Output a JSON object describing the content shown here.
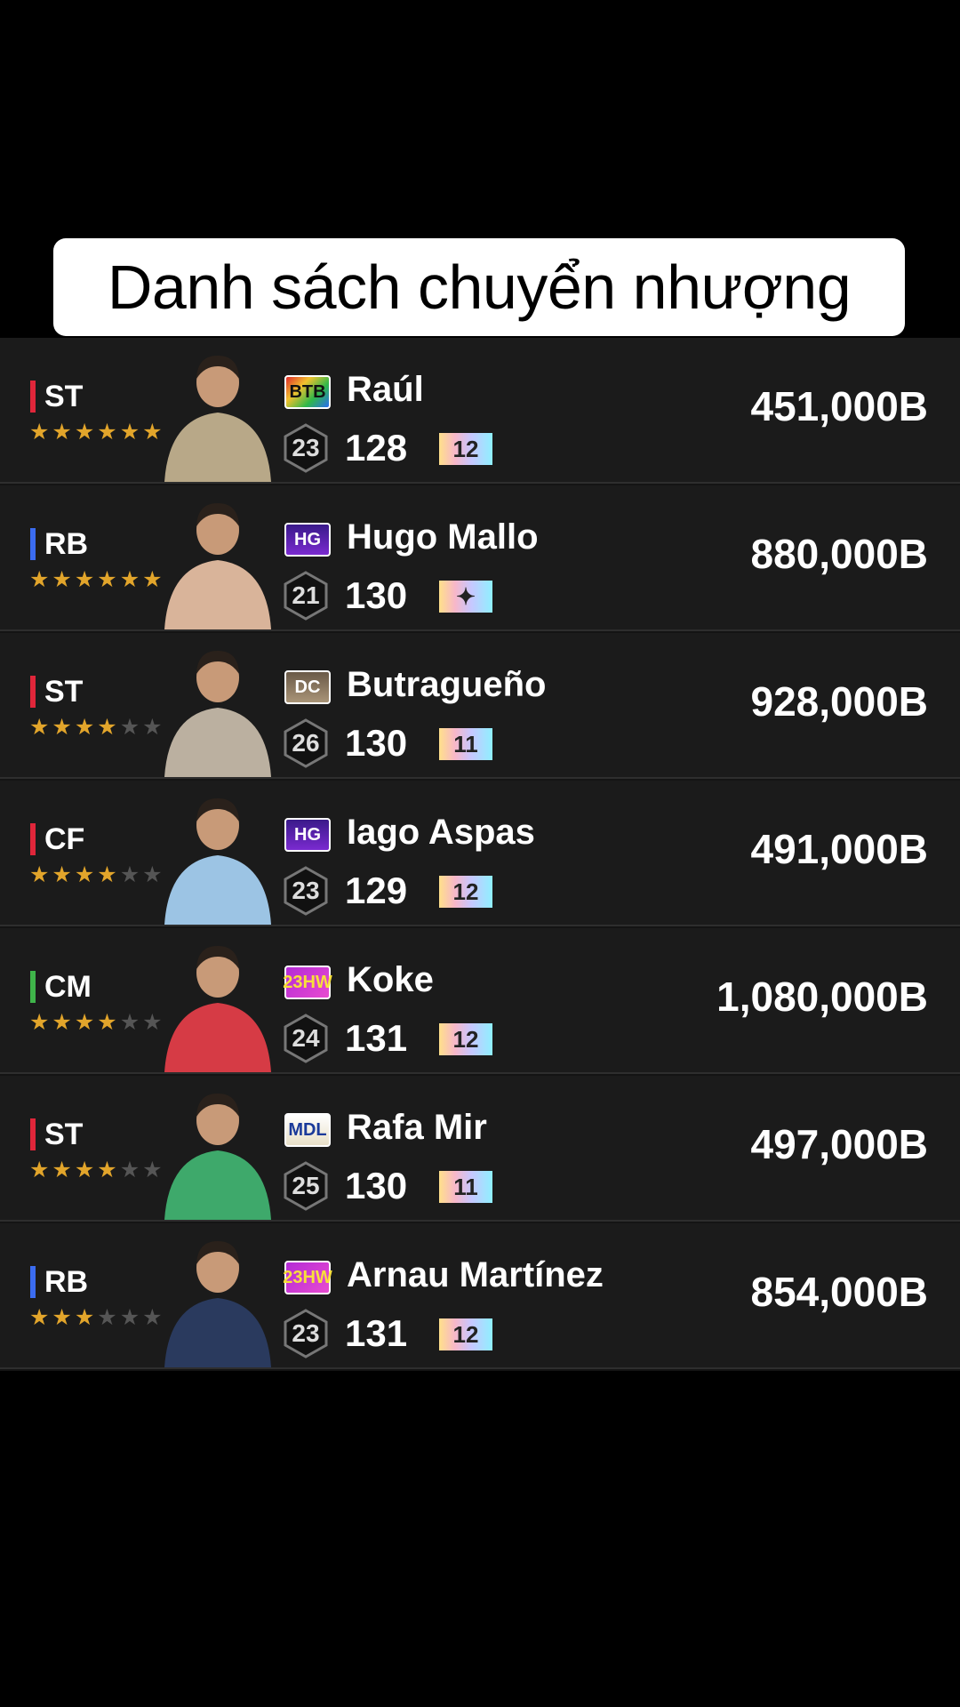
{
  "title": "Danh sách chuyển nhượng",
  "players": [
    {
      "position": "ST",
      "position_color": "#e0263a",
      "stars": 6,
      "card": "BTB",
      "card_style": "btb",
      "name": "Raúl",
      "reinforce": "23",
      "ovr": "128",
      "level": "12",
      "price": "451,000B",
      "photo_tone": "#b8a888"
    },
    {
      "position": "RB",
      "position_color": "#3b6cf0",
      "stars": 6,
      "card": "HG",
      "card_style": "hg",
      "name": "Hugo Mallo",
      "reinforce": "21",
      "ovr": "130",
      "level": "✦",
      "price": "880,000B",
      "photo_tone": "#d9b49a"
    },
    {
      "position": "ST",
      "position_color": "#e0263a",
      "stars": 4,
      "card": "DC",
      "card_style": "dc",
      "name": "Butragueño",
      "reinforce": "26",
      "ovr": "130",
      "level": "11",
      "price": "928,000B",
      "photo_tone": "#bbb0a0"
    },
    {
      "position": "CF",
      "position_color": "#e0263a",
      "stars": 4,
      "card": "HG",
      "card_style": "hg",
      "name": "Iago Aspas",
      "reinforce": "23",
      "ovr": "129",
      "level": "12",
      "price": "491,000B",
      "photo_tone": "#9cc4e4"
    },
    {
      "position": "CM",
      "position_color": "#3fb44a",
      "stars": 4,
      "card": "23HW",
      "card_style": "hw",
      "name": "Koke",
      "reinforce": "24",
      "ovr": "131",
      "level": "12",
      "price": "1,080,000B",
      "photo_tone": "#d63b45"
    },
    {
      "position": "ST",
      "position_color": "#e0263a",
      "stars": 4,
      "card": "MDL",
      "card_style": "mdl",
      "name": "Rafa Mir",
      "reinforce": "25",
      "ovr": "130",
      "level": "11",
      "price": "497,000B",
      "photo_tone": "#3ea96b"
    },
    {
      "position": "RB",
      "position_color": "#3b6cf0",
      "stars": 3,
      "card": "23HW",
      "card_style": "hw",
      "name": "Arnau Martínez",
      "reinforce": "23",
      "ovr": "131",
      "level": "12",
      "price": "854,000B",
      "photo_tone": "#2a3a5e"
    }
  ]
}
